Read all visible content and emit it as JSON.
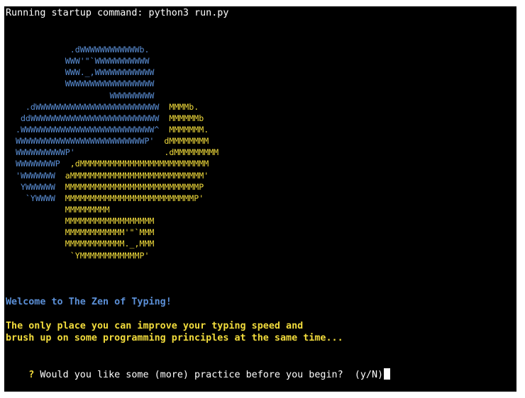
{
  "terminal": {
    "startup_line": "Running startup command: python3 run.py",
    "logo_rows": [
      [
        {
          "c": "blue",
          "t": "             .dWWWWWWWWWWWWb."
        }
      ],
      [
        {
          "c": "blue",
          "t": "            WWW'\"`WWWWWWWWWWW"
        }
      ],
      [
        {
          "c": "blue",
          "t": "            WWW._,WWWWWWWWWWWW"
        }
      ],
      [
        {
          "c": "blue",
          "t": "            WWWWWWWWWWWWWWWWWW"
        }
      ],
      [
        {
          "c": "blue",
          "t": "                     WWWWWWWWW"
        }
      ],
      [
        {
          "c": "blue",
          "t": "    .dWWWWWWWWWWWWWWWWWWWWWWWWW  "
        },
        {
          "c": "yellow",
          "t": "MMMMb."
        }
      ],
      [
        {
          "c": "blue",
          "t": "   ddWWWWWWWWWWWWWWWWWWWWWWWWWW  "
        },
        {
          "c": "yellow",
          "t": "MMMMMMb"
        }
      ],
      [
        {
          "c": "blue",
          "t": "  .WWWWWWWWWWWWWWWWWWWWWWWWWWW^  "
        },
        {
          "c": "yellow",
          "t": "MMMMMMM."
        }
      ],
      [
        {
          "c": "blue",
          "t": "  WWWWWWWWWWWWWWWWWWWWWWWWWWP'  "
        },
        {
          "c": "yellow",
          "t": "dMMMMMMMM"
        }
      ],
      [
        {
          "c": "blue",
          "t": "  WWWWWWWWWWP'"
        },
        {
          "c": "yellow",
          "t": "                  .dMMMMMMMMM"
        }
      ],
      [
        {
          "c": "blue",
          "t": "  WWWWWWWWP  "
        },
        {
          "c": "yellow",
          "t": ",dMMMMMMMMMMMMMMMMMMMMMMMMMM"
        }
      ],
      [
        {
          "c": "blue",
          "t": "  'WWWWWWW  "
        },
        {
          "c": "yellow",
          "t": "aMMMMMMMMMMMMMMMMMMMMMMMMMMM'"
        }
      ],
      [
        {
          "c": "blue",
          "t": "   YWWWWWW  "
        },
        {
          "c": "yellow",
          "t": "MMMMMMMMMMMMMMMMMMMMMMMMMMMP"
        }
      ],
      [
        {
          "c": "blue",
          "t": "    `YWWWW  "
        },
        {
          "c": "yellow",
          "t": "MMMMMMMMMMMMMMMMMMMMMMMMMMP'"
        }
      ],
      [
        {
          "c": "yellow",
          "t": "            MMMMMMMMM"
        }
      ],
      [
        {
          "c": "yellow",
          "t": "            MMMMMMMMMMMMMMMMMM"
        }
      ],
      [
        {
          "c": "yellow",
          "t": "            MMMMMMMMMMMM'\"`MMM"
        }
      ],
      [
        {
          "c": "yellow",
          "t": "            MMMMMMMMMMMM._,MMM"
        }
      ],
      [
        {
          "c": "yellow",
          "t": "             `YMMMMMMMMMMMMP'"
        }
      ]
    ],
    "welcome": "Welcome to The Zen of Typing!",
    "intro_line1": "The only place you can improve your typing speed and",
    "intro_line2": "brush up on some programming principles at the same time...",
    "prompt_marker": "?",
    "prompt_text": " Would you like some (more) practice before you begin?  (y/N)"
  },
  "colors": {
    "background": "#000000",
    "blue": "#5b8fd6",
    "yellow": "#f2dc3c",
    "text": "#ffffff"
  }
}
